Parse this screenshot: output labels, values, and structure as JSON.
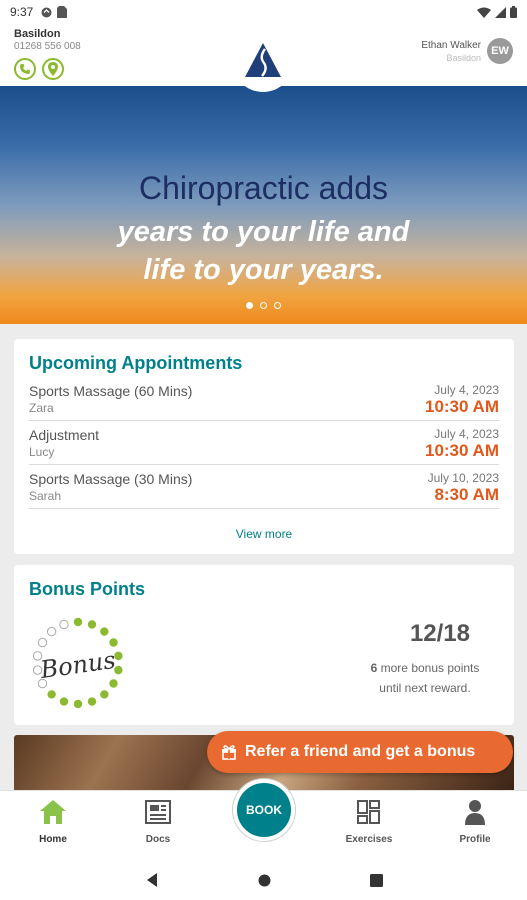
{
  "status_bar": {
    "time": "9:37"
  },
  "header": {
    "clinic_name": "Basildon",
    "clinic_phone": "01268 556 008",
    "user_name": "Ethan Walker",
    "user_location": "Basildon",
    "user_initials": "EW"
  },
  "hero": {
    "line1": "Chiropractic adds",
    "line2": "years to your life and",
    "line3": "life to your years."
  },
  "appointments": {
    "title": "Upcoming Appointments",
    "items": [
      {
        "service": "Sports Massage (60 Mins)",
        "staff": "Zara",
        "date": "July 4, 2023",
        "time": "10:30 AM"
      },
      {
        "service": "Adjustment",
        "staff": "Lucy",
        "date": "July 4, 2023",
        "time": "10:30 AM"
      },
      {
        "service": "Sports Massage (30 Mins)",
        "staff": "Sarah",
        "date": "July 10, 2023",
        "time": "8:30 AM"
      }
    ],
    "view_more": "View more"
  },
  "bonus": {
    "title": "Bonus Points",
    "stamp_text": "Bonus",
    "points_collected": 12,
    "points_total": 18,
    "count_label": "12/18",
    "remaining": "6",
    "remaining_line1": "more bonus points",
    "remaining_line2": "until next reward."
  },
  "promo": {
    "label": "Refer a friend and get a bonus"
  },
  "nav": {
    "home": "Home",
    "docs": "Docs",
    "book": "BOOK",
    "exercises": "Exercises",
    "profile": "Profile"
  },
  "colors": {
    "accent_teal": "#00808a",
    "accent_green": "#8bb92f",
    "accent_orange": "#e2581b"
  }
}
